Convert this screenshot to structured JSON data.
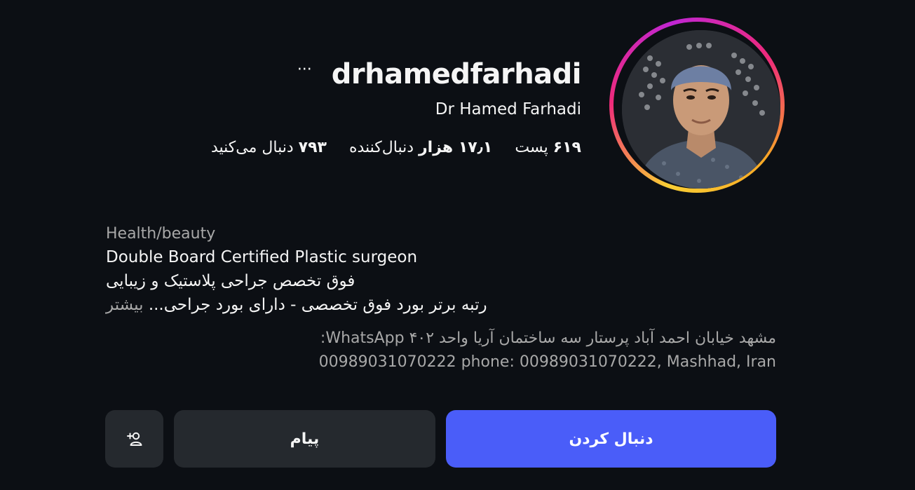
{
  "profile": {
    "username": "drhamedfarhadi",
    "more_glyph": "···",
    "full_name": "Dr Hamed Farhadi",
    "avatar_icon": "avatar"
  },
  "stats": {
    "posts": {
      "count": "۶۱۹",
      "label": "پست"
    },
    "followers": {
      "count": "۱۷٫۱ هزار",
      "label": "دنبال‌کننده"
    },
    "following": {
      "count": "۷۹۳",
      "label": "دنبال می‌کنید"
    }
  },
  "bio": {
    "category": "Health/beauty",
    "line1": "Double Board Certified Plastic surgeon",
    "line2": "فوق تخصص جراحی پلاستیک و زیبایی",
    "line3": "رتبه برتر بورد فوق تخصصی - دارای بورد جراحی...",
    "more": "بیشتر",
    "address_line1": "مشهد خیابان احمد آباد پرستار سه ساختمان آریا واحد ۴۰۲ WhatsApp:",
    "address_line2": "00989031070222 phone: 00989031070222, Mashhad, Iran"
  },
  "actions": {
    "follow": "دنبال کردن",
    "message": "پیام",
    "suggest_icon": "add-user-icon"
  },
  "colors": {
    "background": "#0c0f14",
    "accent": "#4a5df9",
    "secondary_button": "#25292e",
    "muted_text": "#a8a8a8"
  }
}
